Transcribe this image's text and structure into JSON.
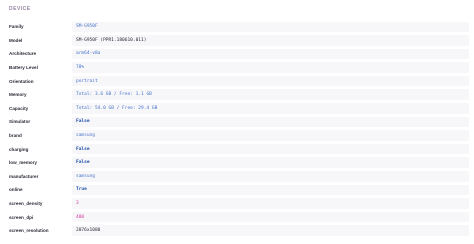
{
  "section": {
    "title": "DEVICE"
  },
  "rows": [
    {
      "key": "Family",
      "value": "SM-G950F",
      "type": "string"
    },
    {
      "key": "Model",
      "value": "SM-G950F (PPR1.180610.011)",
      "type": "plain"
    },
    {
      "key": "Architecture",
      "value": "arm64-v8a",
      "type": "string"
    },
    {
      "key": "Battery Level",
      "value": "78%",
      "type": "string"
    },
    {
      "key": "Orientation",
      "value": "portrait",
      "type": "string"
    },
    {
      "key": "Memory",
      "value": "Total: 3.6 GB / Free: 1.1 GB",
      "type": "string"
    },
    {
      "key": "Capacity",
      "value": "Total: 54.0 GB / Free: 29.4 GB",
      "type": "string"
    },
    {
      "key": "Simulator",
      "value": "False",
      "type": "bool"
    },
    {
      "key": "brand",
      "value": "samsung",
      "type": "string"
    },
    {
      "key": "charging",
      "value": "False",
      "type": "bool"
    },
    {
      "key": "low_memory",
      "value": "False",
      "type": "bool"
    },
    {
      "key": "manufacturer",
      "value": "samsung",
      "type": "string"
    },
    {
      "key": "online",
      "value": "True",
      "type": "bool"
    },
    {
      "key": "screen_density",
      "value": "3",
      "type": "number"
    },
    {
      "key": "screen_dpi",
      "value": "480",
      "type": "number"
    },
    {
      "key": "screen_resolution",
      "value": "2076x1080",
      "type": "plain"
    }
  ],
  "colors": {
    "key_text": "#2f2936",
    "string_value": "#4674ca",
    "bool_value": "#1b4fa8",
    "number_value": "#d33c9b",
    "value_background": "#f7f6f9",
    "section_title": "#9585a3"
  }
}
